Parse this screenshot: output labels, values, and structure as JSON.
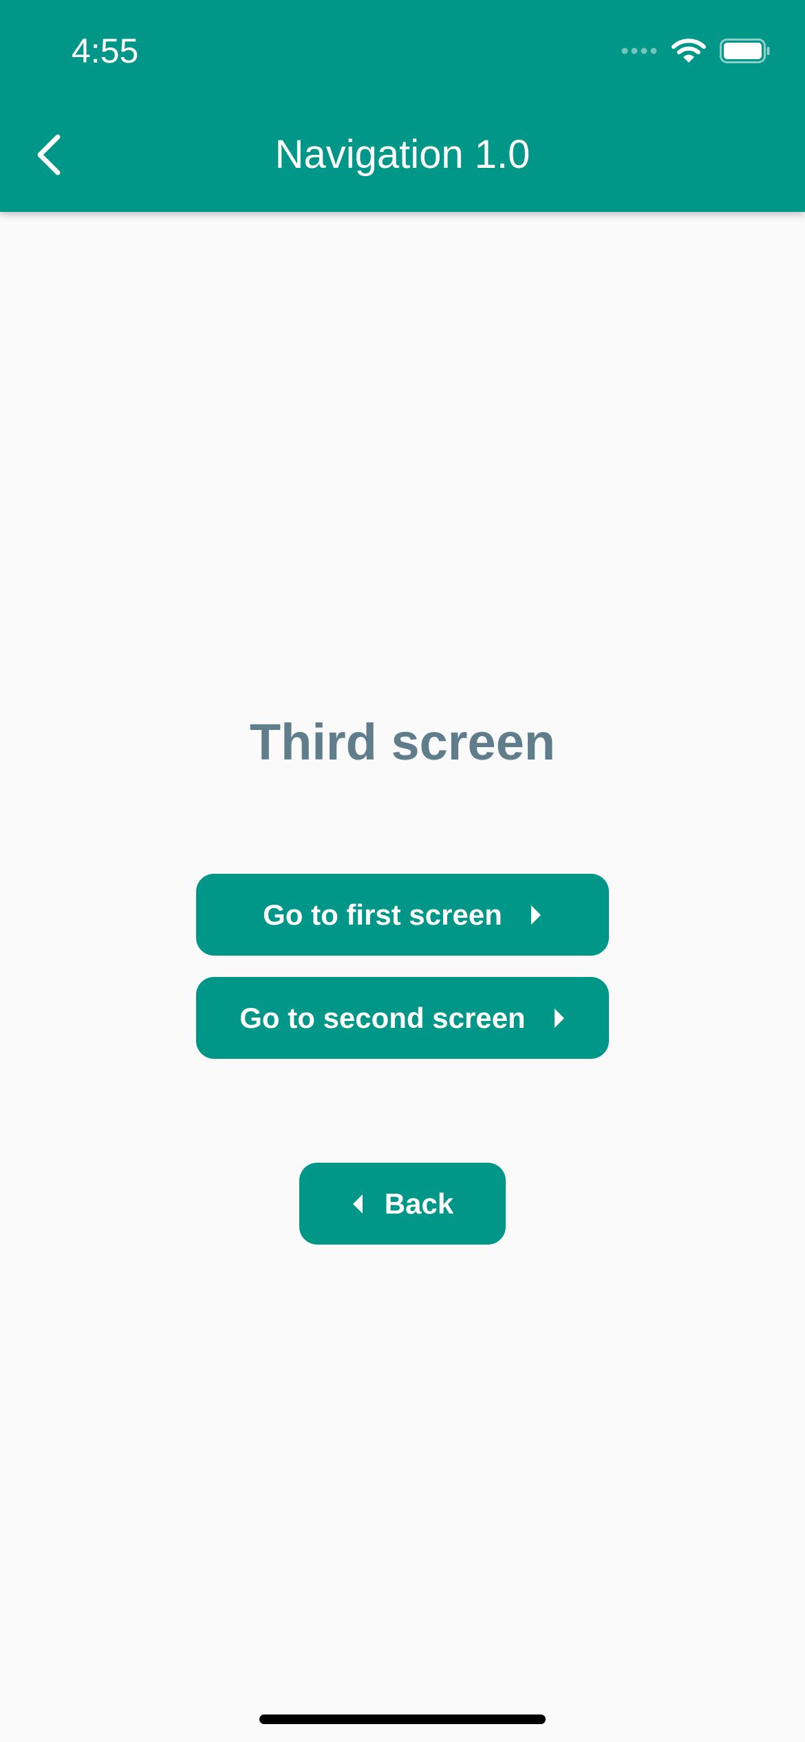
{
  "status_bar": {
    "time": "4:55"
  },
  "nav_bar": {
    "title": "Navigation 1.0",
    "back_icon": "chevron-left-icon"
  },
  "main": {
    "title": "Third screen",
    "buttons": [
      {
        "label": "Go to first screen",
        "icon": "caret-right-icon"
      },
      {
        "label": "Go to second screen",
        "icon": "caret-right-icon"
      }
    ],
    "back_button": {
      "label": "Back",
      "icon": "caret-left-icon"
    }
  },
  "colors": {
    "primary": "#009688",
    "title_text": "#607d8b",
    "background": "#fafafa"
  }
}
